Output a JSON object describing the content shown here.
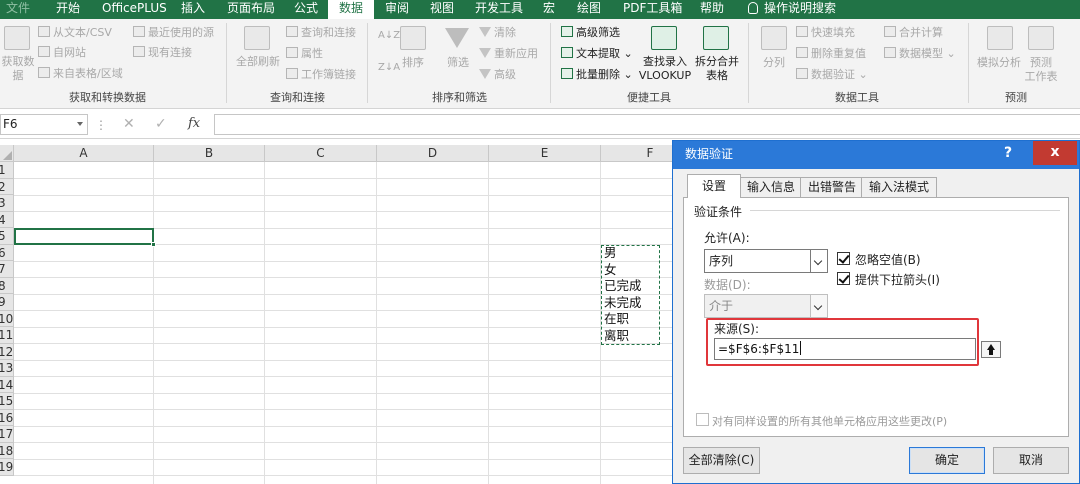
{
  "menu": {
    "tabs": [
      "文件",
      "开始",
      "OfficePLUS",
      "插入",
      "页面布局",
      "公式",
      "数据",
      "审阅",
      "视图",
      "开发工具",
      "宏",
      "绘图",
      "PDF工具箱",
      "帮助"
    ],
    "active_tab": "数据",
    "tell_me": "操作说明搜索"
  },
  "ribbon": {
    "get_data": {
      "big_button": "获取数\n据",
      "items": [
        "从文本/CSV",
        "最近使用的源",
        "自网站",
        "现有连接",
        "来自表格/区域"
      ],
      "label": "获取和转换数据"
    },
    "queries": {
      "refresh_all": "全部刷新",
      "items": [
        "查询和连接",
        "属性",
        "工作簿链接"
      ],
      "label": "查询和连接"
    },
    "sort_filter": {
      "sort_az": "A↓Z",
      "sort_za": "Z↓A",
      "sort": "排序",
      "filter": "筛选",
      "clear": "清除",
      "reapply": "重新应用",
      "advanced": "高级",
      "label": "排序和筛选"
    },
    "convenient": {
      "advanced_filter": "高级筛选",
      "text_extract": "文本提取",
      "batch_delete": "批量删除",
      "lookup": "查找录入\nVLOOKUP",
      "split_merge": "拆分合并\n表格",
      "label": "便捷工具"
    },
    "data_tools": {
      "split": "分列",
      "flash_fill": "快速填充",
      "remove_dup": "删除重复值",
      "validation": "数据验证",
      "consolidate": "合并计算",
      "data_model": "数据模型",
      "label": "数据工具"
    },
    "forecast": {
      "what_if": "模拟分析",
      "forecast_sheet": "预测\n工作表",
      "label": "预测"
    }
  },
  "formula_bar": {
    "name_box": "F6",
    "fx": "fx",
    "value": ""
  },
  "sheet": {
    "columns": [
      "A",
      "B",
      "C",
      "D",
      "E",
      "F"
    ],
    "rows": [
      "1",
      "2",
      "3",
      "4",
      "5",
      "6",
      "7",
      "8",
      "9",
      "10",
      "11",
      "12",
      "13",
      "14",
      "15",
      "16",
      "17",
      "18",
      "19"
    ],
    "f_values": [
      "男",
      "女",
      "已完成",
      "未完成",
      "在职",
      "离职"
    ]
  },
  "dialog": {
    "title": "数据验证",
    "help": "?",
    "close": "x",
    "tabs": [
      "设置",
      "输入信息",
      "出错警告",
      "输入法模式"
    ],
    "criteria_label": "验证条件",
    "allow_label": "允许(A):",
    "allow_value": "序列",
    "ignore_blank": "忽略空值(B)",
    "in_cell_dropdown": "提供下拉箭头(I)",
    "data_label": "数据(D):",
    "data_value": "介于",
    "source_label": "来源(S):",
    "source_value": "=$F$6:$F$11",
    "apply_all": "对有同样设置的所有其他单元格应用这些更改(P)",
    "clear_all": "全部清除(C)",
    "ok": "确定",
    "cancel": "取消"
  }
}
